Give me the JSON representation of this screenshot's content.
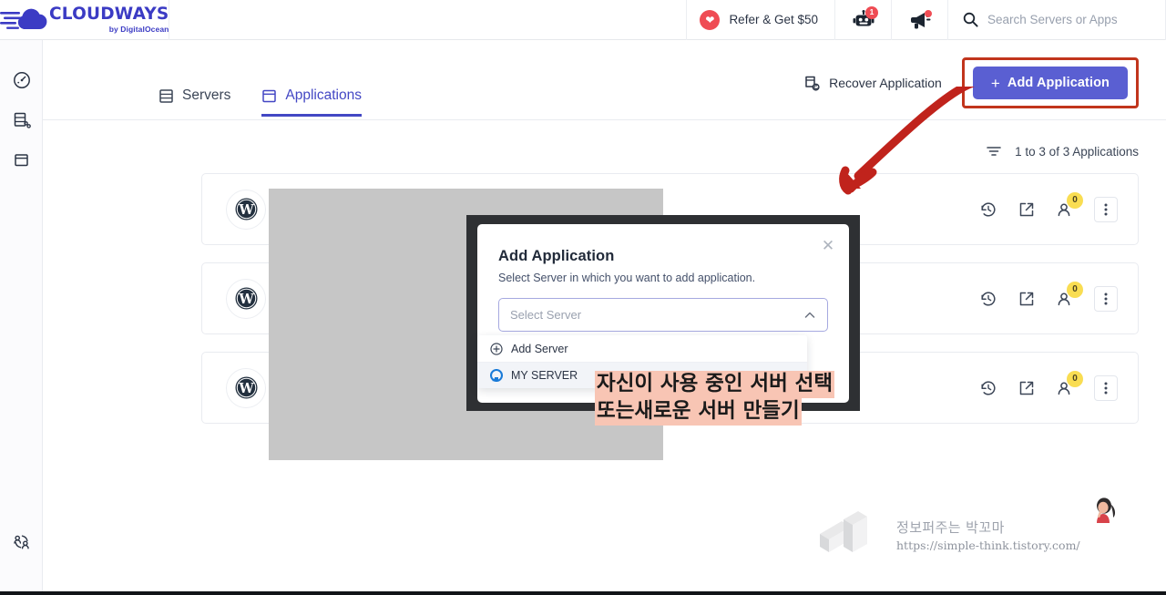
{
  "brand": {
    "name": "CLOUDWAYS",
    "sub": "by DigitalOcean",
    "accent": "#3b3bc4",
    "primary_button": "#5a5fd2",
    "highlight_border": "#c1351c"
  },
  "topbar": {
    "refer_label": "Refer & Get $50",
    "bot_badge": "1",
    "search_placeholder": "Search Servers or Apps",
    "search_value": ""
  },
  "sidebar": {
    "items": [
      {
        "name": "dashboard",
        "icon": "gauge-icon"
      },
      {
        "name": "servers",
        "icon": "server-stack-icon"
      },
      {
        "name": "applications",
        "icon": "application-window-icon"
      }
    ],
    "bottom": {
      "name": "team-transfer",
      "icon": "users-transfer-icon"
    }
  },
  "actions": {
    "recover_label": "Recover Application",
    "add_label": "Add Application",
    "add_plus": "+"
  },
  "tabs": [
    {
      "label": "Servers",
      "icon": "server-icon",
      "active": false
    },
    {
      "label": "Applications",
      "icon": "application-icon",
      "active": true
    }
  ],
  "list": {
    "count_label": "1 to 3 of 3 Applications",
    "filter_icon": "filter-icon"
  },
  "cards": [
    {
      "app_icon": "wordpress-icon",
      "name": "",
      "history_icon": "history-icon",
      "launch_icon": "external-link-icon",
      "users_icon": "user-icon",
      "users_count": "0",
      "menu_icon": "kebab-menu-icon"
    },
    {
      "app_icon": "wordpress-icon",
      "name": "",
      "history_icon": "history-icon",
      "launch_icon": "external-link-icon",
      "users_icon": "user-icon",
      "users_count": "0",
      "menu_icon": "kebab-menu-icon"
    },
    {
      "app_icon": "wordpress-icon",
      "name": "",
      "history_icon": "history-icon",
      "launch_icon": "external-link-icon",
      "users_icon": "user-icon",
      "users_count": "0",
      "menu_icon": "kebab-menu-icon"
    }
  ],
  "modal": {
    "title": "Add Application",
    "subtitle": "Select Server in which you want to add application.",
    "close_icon": "close-icon",
    "select": {
      "placeholder": "Select Server",
      "value": "",
      "chevron": "chevron-up-icon",
      "open": true
    },
    "options": [
      {
        "label": "Add Server",
        "icon": "plus-circle-icon",
        "selected": false
      },
      {
        "label": "MY SERVER",
        "icon": "digitalocean-icon",
        "selected": true
      }
    ]
  },
  "annotations": {
    "arrow_color": "#c0231c",
    "note_line1": "자신이 사용 중인 서버 선택",
    "note_line2": "또는새로운 서버 만들기",
    "note_highlight": "#f8c5b4"
  },
  "watermark": {
    "name": "정보퍼주는 박꼬마",
    "url": "https://simple-think.tistory.com/"
  }
}
